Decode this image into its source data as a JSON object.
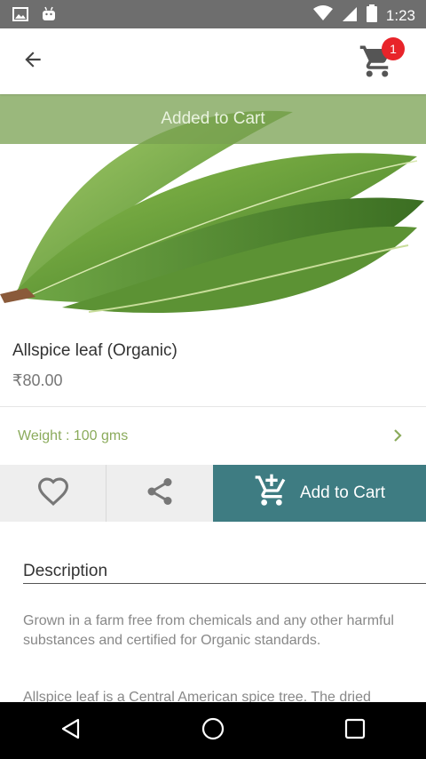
{
  "status_bar": {
    "time": "1:23"
  },
  "header": {
    "cart_count": "1"
  },
  "toast": {
    "message": "Added to Cart"
  },
  "product": {
    "name": "Allspice leaf (Organic)",
    "price": "₹80.00",
    "weight_label": "Weight : 100 gms"
  },
  "actions": {
    "add_to_cart_label": "Add to Cart"
  },
  "description": {
    "title": "Description",
    "paragraph1": "Grown in a farm free from chemicals and any other harmful substances and certified for Organic standards.",
    "paragraph2": "Allspice leaf is a Central American spice tree. The dried"
  },
  "colors": {
    "accent": "#3e7c82",
    "toast": "#78a050",
    "badge": "#e8242a",
    "weight_text": "#8bab5c"
  },
  "icons": [
    "image-icon",
    "android-icon",
    "wifi-icon",
    "sim-icon",
    "battery-icon",
    "back-arrow-icon",
    "cart-icon",
    "heart-icon",
    "share-icon",
    "cart-add-icon",
    "chevron-right-icon",
    "nav-back-icon",
    "nav-home-icon",
    "nav-recents-icon"
  ]
}
